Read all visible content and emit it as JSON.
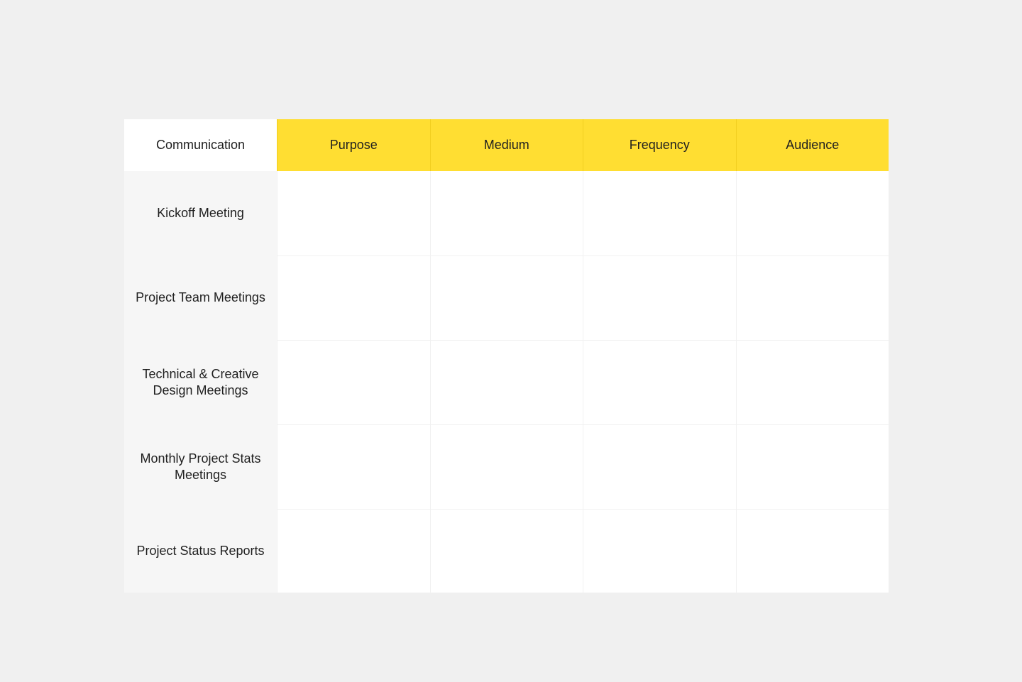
{
  "table": {
    "corner_label": "Communication",
    "columns": [
      "Purpose",
      "Medium",
      "Frequency",
      "Audience"
    ],
    "rows": [
      {
        "label": "Kickoff Meeting",
        "cells": [
          "",
          "",
          "",
          ""
        ]
      },
      {
        "label": "Project Team Meetings",
        "cells": [
          "",
          "",
          "",
          ""
        ]
      },
      {
        "label": "Technical & Creative Design Meetings",
        "cells": [
          "",
          "",
          "",
          ""
        ]
      },
      {
        "label": "Monthly Project Stats Meetings",
        "cells": [
          "",
          "",
          "",
          ""
        ]
      },
      {
        "label": "Project Status Reports",
        "cells": [
          "",
          "",
          "",
          ""
        ]
      }
    ]
  },
  "colors": {
    "background": "#f0f0f0",
    "header_accent": "#ffde32",
    "row_header_background": "#f6f6f6",
    "cell_background": "#ffffff"
  }
}
